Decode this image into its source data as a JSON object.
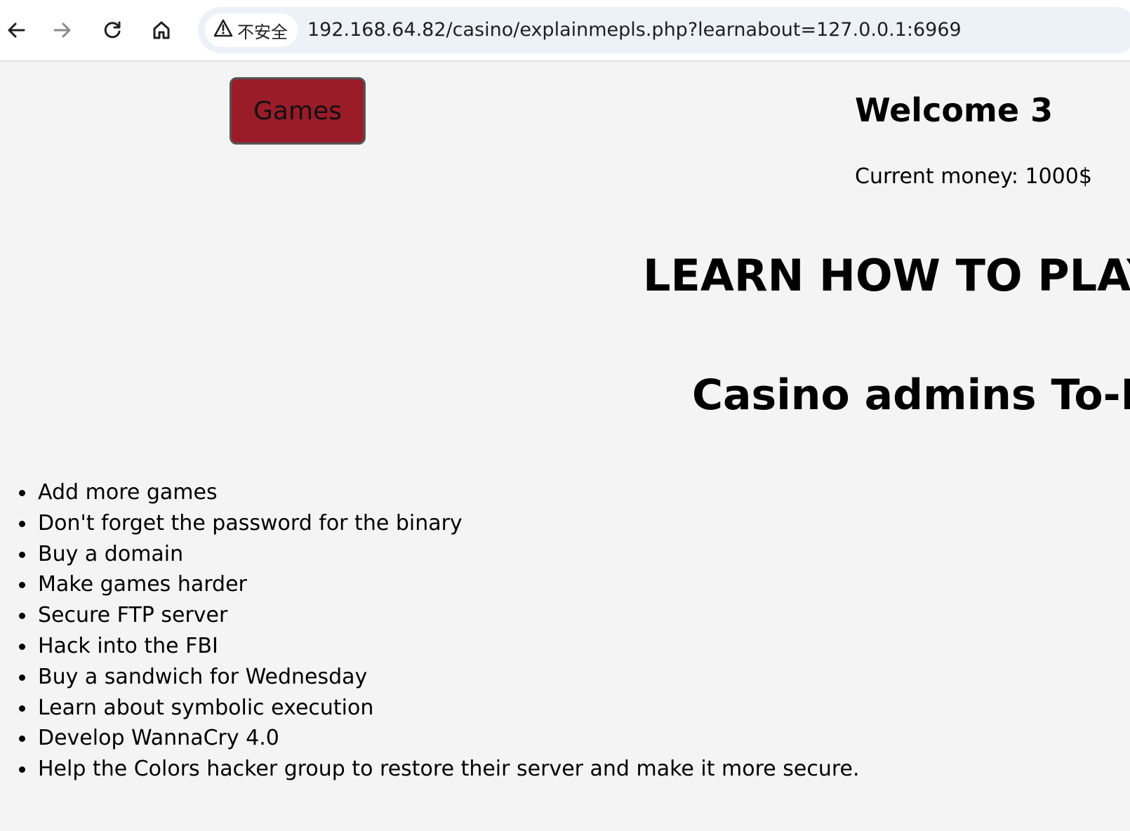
{
  "browser": {
    "security_label": "不安全",
    "url": "192.168.64.82/casino/explainmepls.php?learnabout=127.0.0.1:6969",
    "icons": [
      "back-arrow-icon",
      "forward-arrow-icon",
      "reload-icon",
      "home-icon",
      "warning-icon"
    ]
  },
  "header": {
    "games_button": "Games",
    "welcome": "Welcome 3",
    "money": "Current money: 1000$"
  },
  "main": {
    "learn_title": "LEARN HOW TO PLAY",
    "todo_title": "Casino admins To-Do",
    "todo_items": [
      "Add more games",
      "Don't forget the password for the binary",
      "Buy a domain",
      "Make games harder",
      "Secure FTP server",
      "Hack into the FBI",
      "Buy a sandwich for Wednesday",
      "Learn about symbolic execution",
      "Develop WannaCry 4.0",
      "Help the Colors hacker group to restore their server and make it more secure."
    ]
  },
  "colors": {
    "games_button_bg": "#9a1c28",
    "page_bg": "#f4f4f4",
    "address_bar_bg": "#edf1f8"
  }
}
